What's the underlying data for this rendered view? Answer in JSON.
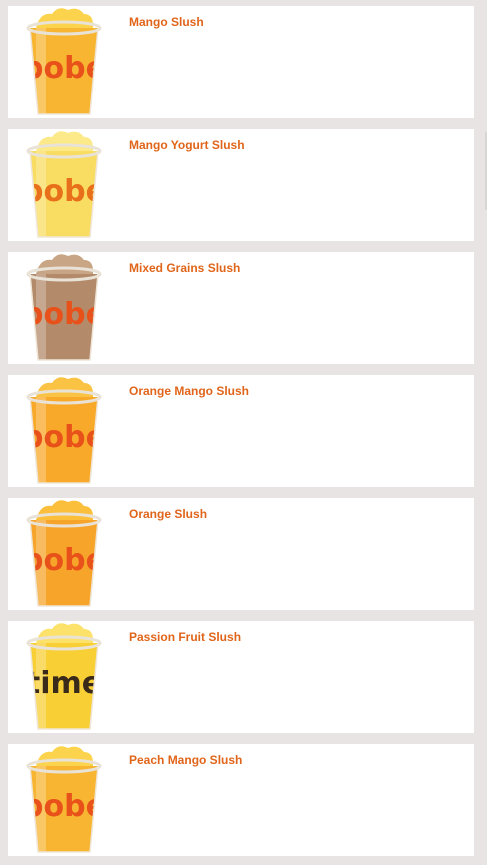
{
  "products": [
    {
      "name": "Mango Slush",
      "drink_color": "#f7b531",
      "top_color": "#fcd34d",
      "brand_text": "bobe",
      "brand_color": "#e8521a"
    },
    {
      "name": "Mango Yogurt Slush",
      "drink_color": "#f9dc62",
      "top_color": "#fbe98a",
      "brand_text": "bobe",
      "brand_color": "#e8701a"
    },
    {
      "name": "Mixed Grains Slush",
      "drink_color": "#b38a6a",
      "top_color": "#c8a585",
      "brand_text": "bobe",
      "brand_color": "#e8521a"
    },
    {
      "name": "Orange Mango Slush",
      "drink_color": "#f8a92a",
      "top_color": "#fbc343",
      "brand_text": "bobe",
      "brand_color": "#e8521a"
    },
    {
      "name": "Orange Slush",
      "drink_color": "#f7a52a",
      "top_color": "#fbbf3c",
      "brand_text": "bobe",
      "brand_color": "#e8521a"
    },
    {
      "name": "Passion Fruit Slush",
      "drink_color": "#f8cf34",
      "top_color": "#fce26a",
      "brand_text": "time",
      "brand_color": "#3a2a1a"
    },
    {
      "name": "Peach Mango Slush",
      "drink_color": "#f7b531",
      "top_color": "#fcd34d",
      "brand_text": "bobe",
      "brand_color": "#e8521a"
    }
  ],
  "colors": {
    "title": "#e0651a",
    "card_bg": "#ffffff",
    "page_bg": "#e8e4e4"
  }
}
